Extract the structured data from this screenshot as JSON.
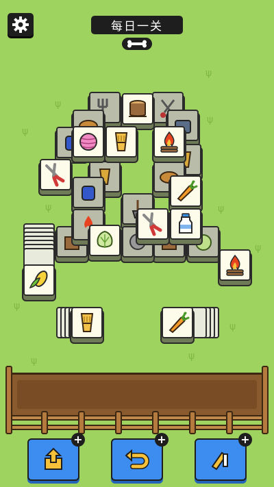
{
  "header": {
    "title": "每日一关",
    "settings_icon": "gear-icon",
    "badge_icon": "bone-icon"
  },
  "board": {
    "tile_icons": [
      "carrot",
      "corn",
      "campfire",
      "yarn-ball",
      "wheat",
      "shears",
      "cabbage",
      "milk-bottle",
      "tree-stump",
      "glove",
      "shovel",
      "fork",
      "bread"
    ]
  },
  "tray": {
    "slots": 7
  },
  "toolbar": {
    "buttons": [
      {
        "name": "move-out",
        "icon": "up-arrow-box-icon"
      },
      {
        "name": "undo",
        "icon": "undo-arrow-icon"
      },
      {
        "name": "shuffle",
        "icon": "shuffle-icon"
      }
    ],
    "plus_label": "+"
  },
  "colors": {
    "background": "#9fd35f",
    "tile": "#fdfbe9",
    "tray": "#8a5a2f",
    "button": "#3d8df0"
  }
}
